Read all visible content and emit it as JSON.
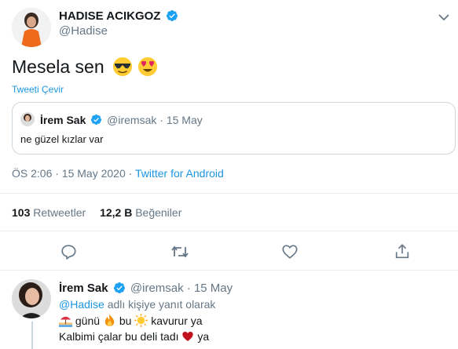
{
  "main_tweet": {
    "author_name": "HADISE ACIKGOZ",
    "author_handle": "@Hadise",
    "text": "Mesela sen",
    "emojis": [
      "smiling-face-with-sunglasses",
      "smiling-face-with-heart-eyes"
    ],
    "translate_label": "Tweeti Çevir",
    "time": "ÖS 2:06 · 15 May 2020",
    "separator": "·",
    "source": "Twitter for Android"
  },
  "quoted_tweet": {
    "author_name": "İrem Sak",
    "author_handle": "@iremsak",
    "date": "· 15 May",
    "text": "ne güzel kızlar var"
  },
  "stats": {
    "retweets_count": "103",
    "retweets_label": "Retweetler",
    "likes_count": "12,2 B",
    "likes_label": "Beğeniler"
  },
  "actions": [
    "reply-icon",
    "retweet-icon",
    "like-icon",
    "share-icon"
  ],
  "reply_tweet": {
    "author_name": "İrem Sak",
    "author_handle": "@iremsak",
    "date": "· 15 May",
    "reply_to_handle": "@Hadise",
    "reply_to_suffix": "adlı kişiye yanıt olarak",
    "line1_words": [
      "günü",
      "bu",
      "kavurur ya"
    ],
    "line1_emojis": [
      "beach-with-umbrella",
      "fire",
      "sun"
    ],
    "line2_text": "Kalbimi çalar bu deli tadı",
    "line2_suffix": "ya",
    "line2_emoji": "red-heart"
  },
  "colors": {
    "link_blue": "#1b95e0",
    "verified_blue": "#1da1f2",
    "grey_text": "#657786",
    "border": "#e6ecf0",
    "heart_red": "#c1121f"
  }
}
